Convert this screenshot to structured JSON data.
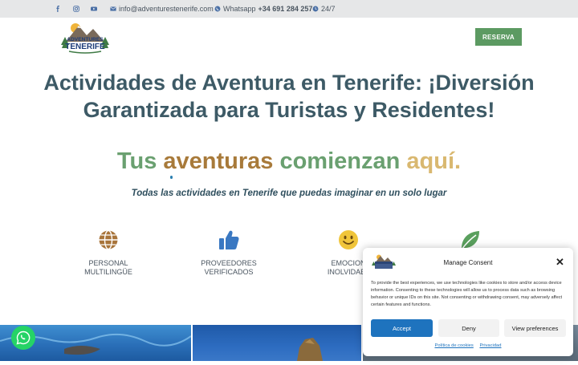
{
  "topbar": {
    "email": "info@adventurestenerife.com",
    "whatsapp_label": "Whatsapp",
    "whatsapp_number": "+34 691 284 257",
    "hours": "24/7",
    "icons": [
      "facebook-icon",
      "instagram-icon",
      "youtube-icon",
      "envelope-icon",
      "whatsapp-icon",
      "clock-icon"
    ]
  },
  "header": {
    "logo_line1": "ADVENTURES",
    "logo_line2": "TENERIFE",
    "reserve_label": "RESERVA"
  },
  "hero": {
    "title_line1": "Actividades de Aventura en Tenerife: ¡Diversión",
    "title_line2": "Garantizada para Turistas y Residentes!",
    "tagline_words": [
      "Tus",
      "aventuras",
      "comienzan",
      "aquí."
    ],
    "subtitle": "Todas las actividades en Tenerife que puedas imaginar en un solo lugar"
  },
  "features": [
    {
      "icon": "globe-icon",
      "line1": "PERSONAL",
      "line2": "MULTILINGÜE"
    },
    {
      "icon": "thumbs-up-icon",
      "line1": "PROVEEDORES",
      "line2": "VERIFICADOS"
    },
    {
      "icon": "smile-icon",
      "line1": "EMOCION",
      "line2": "INOLVIDABL"
    },
    {
      "icon": "leaf-icon",
      "line1": "",
      "line2": ""
    }
  ],
  "colors": {
    "title": "#3d5a66",
    "green": "#6aa070",
    "brown": "#a87a3a",
    "gold": "#d9b870",
    "reserve_button": "#5c9a62",
    "accept_button": "#1e73be",
    "whatsapp": "#25d366"
  },
  "consent": {
    "title": "Manage Consent",
    "body": "To provide the best experiences, we use technologies like cookies to store and/or access device information. Consenting to these technologies will allow us to process data such as browsing behavior or unique IDs on this site. Not consenting or withdrawing consent, may adversely affect certain features and functions.",
    "accept_label": "Accept",
    "deny_label": "Deny",
    "preferences_label": "View preferences",
    "cookie_policy_label": "Política de cookies",
    "privacy_label": "Privacidad"
  }
}
